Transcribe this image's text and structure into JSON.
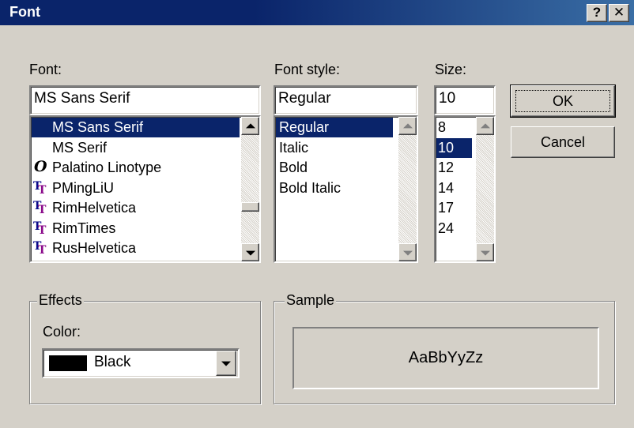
{
  "window": {
    "title": "Font",
    "help_glyph": "?",
    "close_glyph": "✕"
  },
  "font": {
    "label": "Font:",
    "value": "MS Sans Serif",
    "items": [
      {
        "name": "MS Sans Serif",
        "icon": "none",
        "selected": true
      },
      {
        "name": "MS Serif",
        "icon": "none",
        "selected": false
      },
      {
        "name": "Palatino Linotype",
        "icon": "opentype-icon",
        "selected": false
      },
      {
        "name": "PMingLiU",
        "icon": "truetype-icon",
        "selected": false
      },
      {
        "name": "RimHelvetica",
        "icon": "truetype-icon",
        "selected": false
      },
      {
        "name": "RimTimes",
        "icon": "truetype-icon",
        "selected": false
      },
      {
        "name": "RusHelvetica",
        "icon": "truetype-icon",
        "selected": false
      }
    ]
  },
  "style": {
    "label": "Font style:",
    "value": "Regular",
    "items": [
      "Regular",
      "Italic",
      "Bold",
      "Bold Italic"
    ]
  },
  "size": {
    "label": "Size:",
    "value": "10",
    "items": [
      "8",
      "10",
      "12",
      "14",
      "17",
      "24"
    ]
  },
  "buttons": {
    "ok": "OK",
    "cancel": "Cancel"
  },
  "effects": {
    "legend": "Effects",
    "color_label": "Color:",
    "color_value": "Black",
    "swatch": "#000000"
  },
  "sample": {
    "legend": "Sample",
    "text": "AaBbYyZz"
  },
  "colors": {
    "face": "#d4d0c8",
    "titlebar": "#0a246a",
    "selection": "#0a246a"
  }
}
